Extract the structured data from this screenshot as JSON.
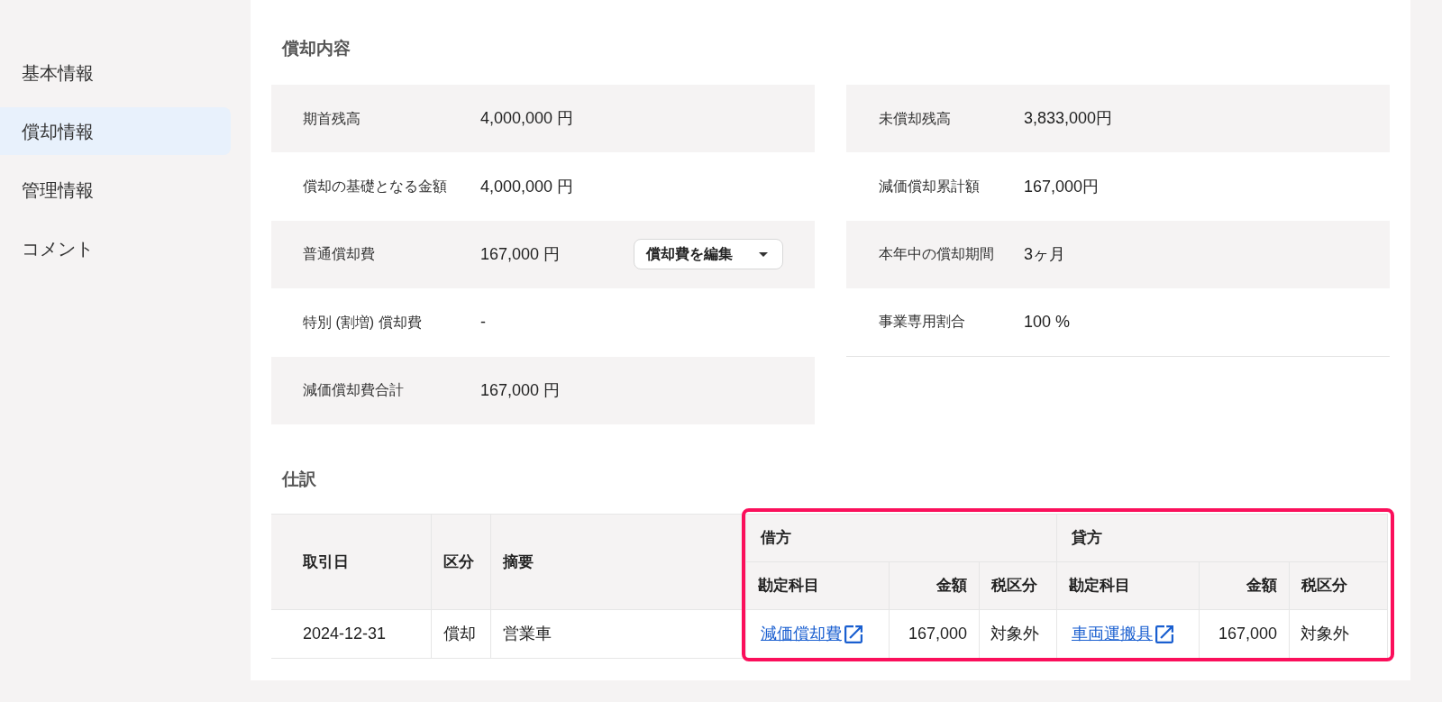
{
  "sidebar": {
    "items": [
      {
        "label": "基本情報",
        "selected": false
      },
      {
        "label": "償却情報",
        "selected": true
      },
      {
        "label": "管理情報",
        "selected": false
      },
      {
        "label": "コメント",
        "selected": false
      }
    ]
  },
  "depreciation": {
    "title": "償却内容",
    "columns": [
      {
        "rows": [
          {
            "label": "期首残高",
            "value": "4,000,000 円"
          },
          {
            "label": "償却の基礎となる金額",
            "value": "4,000,000 円"
          },
          {
            "label": "普通償却費",
            "value": "167,000 円",
            "action": "償却費を編集"
          },
          {
            "label": "特別 (割増) 償却費",
            "value": "-"
          },
          {
            "label": "減価償却費合計",
            "value": "167,000 円"
          }
        ]
      },
      {
        "rows": [
          {
            "label": "未償却残高",
            "value": "3,833,000円"
          },
          {
            "label": "減価償却累計額",
            "value": "167,000円"
          },
          {
            "label": "本年中の償却期間",
            "value": "3ヶ月"
          },
          {
            "label": "事業専用割合",
            "value": "100 %"
          }
        ]
      }
    ]
  },
  "journal": {
    "title": "仕訳",
    "table": {
      "columns": [
        "取引日",
        "区分",
        "摘要"
      ],
      "groups": [
        {
          "label": "借方",
          "columns": [
            {
              "label": "勘定科目",
              "kind": "account"
            },
            {
              "label": "金額",
              "kind": "amount"
            },
            {
              "label": "税区分",
              "kind": "text"
            }
          ]
        },
        {
          "label": "貸方",
          "columns": [
            {
              "label": "勘定科目",
              "kind": "account"
            },
            {
              "label": "金額",
              "kind": "amount"
            },
            {
              "label": "税区分",
              "kind": "text"
            }
          ]
        }
      ],
      "highlight_groups": true,
      "rows": [
        {
          "cells": [
            "2024-12-31",
            "償却",
            "営業車"
          ],
          "groups": [
            [
              "減価償却費",
              "167,000",
              "対象外"
            ],
            [
              "車両運搬具",
              "167,000",
              "対象外"
            ]
          ]
        }
      ]
    }
  }
}
